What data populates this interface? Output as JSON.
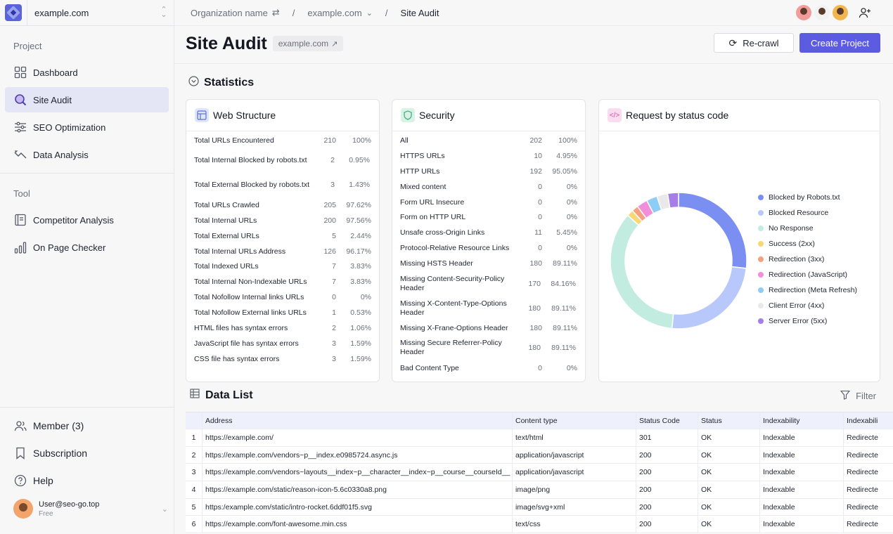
{
  "sidebar": {
    "project_name": "example.com",
    "project_section": "Project",
    "tool_section": "Tool",
    "project_items": [
      {
        "label": "Dashboard"
      },
      {
        "label": "Site Audit"
      },
      {
        "label": "SEO Optimization"
      },
      {
        "label": "Data Analysis"
      }
    ],
    "tool_items": [
      {
        "label": "Competitor Analysis"
      },
      {
        "label": "On Page Checker"
      }
    ],
    "bottom_items": [
      {
        "label": "Member (3)"
      },
      {
        "label": "Subscription"
      },
      {
        "label": "Help"
      }
    ],
    "user": {
      "email": "User@seo-go.top",
      "plan": "Free"
    }
  },
  "breadcrumb": {
    "org": "Organization name",
    "project": "example.com",
    "current": "Site Audit"
  },
  "header": {
    "title": "Site Audit",
    "domain_chip": "example.com",
    "recrawl_label": "Re-crawl",
    "create_label": "Create Project"
  },
  "statistics": {
    "title": "Statistics",
    "web_structure": {
      "title": "Web Structure",
      "rows": [
        {
          "label": "Total URLs Encountered",
          "count": "210",
          "pct": "100%"
        },
        {
          "label": "Total Internal Blocked by robots.txt",
          "count": "2",
          "pct": "0.95%"
        },
        {
          "label": "Total External Blocked by robots.txt",
          "count": "3",
          "pct": "1.43%"
        },
        {
          "label": "Total URLs Crawled",
          "count": "205",
          "pct": "97.62%"
        },
        {
          "label": "Total Internal URLs",
          "count": "200",
          "pct": "97.56%"
        },
        {
          "label": "Total External URLs",
          "count": "5",
          "pct": "2.44%"
        },
        {
          "label": "Total Internal URLs Address",
          "count": "126",
          "pct": "96.17%"
        },
        {
          "label": "Total Indexed URLs",
          "count": "7",
          "pct": "3.83%"
        },
        {
          "label": "Total Internal Non-Indexable URLs",
          "count": "7",
          "pct": "3.83%"
        },
        {
          "label": "Total Nofollow Internal links URLs",
          "count": "0",
          "pct": "0%"
        },
        {
          "label": "Total Nofollow External links URLs",
          "count": "1",
          "pct": "0.53%"
        },
        {
          "label": "HTML files has syntax errors",
          "count": "2",
          "pct": "1.06%"
        },
        {
          "label": "JavaScript file has syntax errors",
          "count": "3",
          "pct": "1.59%"
        },
        {
          "label": "CSS file has syntax errors",
          "count": "3",
          "pct": "1.59%"
        }
      ]
    },
    "security": {
      "title": "Security",
      "rows": [
        {
          "label": "All",
          "count": "202",
          "pct": "100%"
        },
        {
          "label": "HTTPS URLs",
          "count": "10",
          "pct": "4.95%"
        },
        {
          "label": "HTTP URLs",
          "count": "192",
          "pct": "95.05%"
        },
        {
          "label": "Mixed content",
          "count": "0",
          "pct": "0%"
        },
        {
          "label": "Form URL Insecure",
          "count": "0",
          "pct": "0%"
        },
        {
          "label": "Form on HTTP URL",
          "count": "0",
          "pct": "0%"
        },
        {
          "label": "Unsafe cross-Origin Links",
          "count": "11",
          "pct": "5.45%"
        },
        {
          "label": "Protocol-Relative Resource Links",
          "count": "0",
          "pct": "0%"
        },
        {
          "label": "Missing HSTS Header",
          "count": "180",
          "pct": "89.11%"
        },
        {
          "label": "Missing Content-Security-Policy Header",
          "count": "170",
          "pct": "84.16%"
        },
        {
          "label": "Missing X-Content-Type-Options Header",
          "count": "180",
          "pct": "89.11%"
        },
        {
          "label": "Missing X-Frane-Options Header",
          "count": "180",
          "pct": "89.11%"
        },
        {
          "label": "Missing Secure Referrer-Policy Header",
          "count": "180",
          "pct": "89.11%"
        },
        {
          "label": "Bad Content Type",
          "count": "0",
          "pct": "0%"
        }
      ]
    },
    "status_chart": {
      "title": "Request by status code",
      "legend": [
        {
          "label": "Blocked by Robots.txt",
          "color": "#7b8ef2"
        },
        {
          "label": "Blocked Resource",
          "color": "#b8c8fb"
        },
        {
          "label": "No Response",
          "color": "#c2ecdf"
        },
        {
          "label": "Success (2xx)",
          "color": "#f9d777"
        },
        {
          "label": "Redirection (3xx)",
          "color": "#f5a07e"
        },
        {
          "label": "Redirection (JavaScript)",
          "color": "#f28ed9"
        },
        {
          "label": "Redirection (Meta Refresh)",
          "color": "#8ecdf5"
        },
        {
          "label": "Client Error (4xx)",
          "color": "#e9e9ec"
        },
        {
          "label": "Server Error (5xx)",
          "color": "#a57ee8"
        }
      ]
    }
  },
  "chart_data": {
    "type": "pie",
    "title": "Request by status code",
    "categories": [
      "Blocked by Robots.txt",
      "Blocked Resource",
      "No Response",
      "Success (2xx)",
      "Redirection (3xx)",
      "Redirection (JavaScript)",
      "Redirection (Meta Refresh)",
      "Client Error (4xx)",
      "Server Error (5xx)"
    ],
    "values": [
      26,
      24,
      34,
      1.5,
      1.5,
      2.5,
      2.5,
      2.5,
      2.5
    ],
    "legend_position": "right"
  },
  "data_list": {
    "title": "Data List",
    "filter_label": "Filter",
    "columns": [
      "Address",
      "Content type",
      "Status Code",
      "Status",
      "Indexability",
      "Indexabili"
    ],
    "rows": [
      {
        "num": "1",
        "address": "https://example.com/",
        "type": "text/html",
        "code": "301",
        "status": "OK",
        "index": "Indexable",
        "index2": "Redirecte"
      },
      {
        "num": "2",
        "address": "https://example.com/vendors~p__index.e0985724.async.js",
        "type": "application/javascript",
        "code": "200",
        "status": "OK",
        "index": "Indexable",
        "index2": "Redirecte"
      },
      {
        "num": "3",
        "address": "https://example.com/vendors~layouts__index~p__character__index~p__course__courseId__",
        "type": "application/javascript",
        "code": "200",
        "status": "OK",
        "index": "Indexable",
        "index2": "Redirecte"
      },
      {
        "num": "4",
        "address": "https://example.com/static/reason-icon-5.6c0330a8.png",
        "type": "image/png",
        "code": "200",
        "status": "OK",
        "index": "Indexable",
        "index2": "Redirecte"
      },
      {
        "num": "5",
        "address": "https:/example.com/static/intro-rocket.6ddf01f5.svg",
        "type": "image/svg+xml",
        "code": "200",
        "status": "OK",
        "index": "Indexable",
        "index2": "Redirecte"
      },
      {
        "num": "6",
        "address": "https://example.com/font-awesome.min.css",
        "type": "text/css",
        "code": "200",
        "status": "OK",
        "index": "Indexable",
        "index2": "Redirecte"
      }
    ]
  }
}
